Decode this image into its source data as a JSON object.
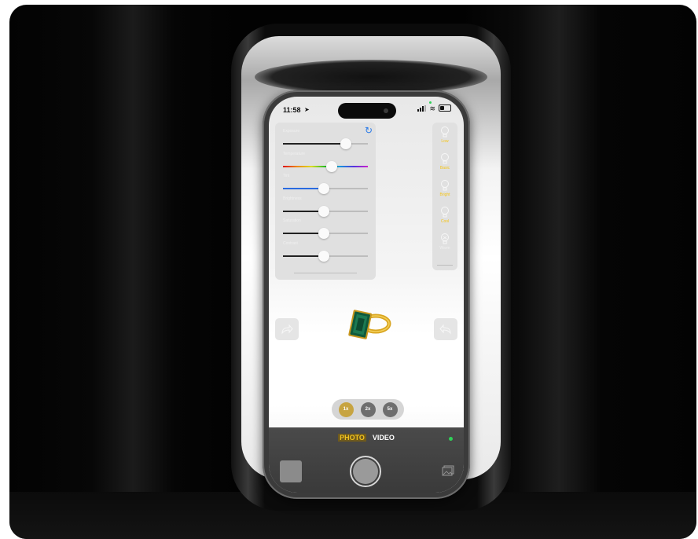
{
  "status_bar": {
    "time": "11:58",
    "location_arrow": "location-arrow-icon",
    "icons": [
      "signal-icon",
      "wifi-icon",
      "battery-icon"
    ]
  },
  "adjustments": {
    "reset_icon": "refresh-icon",
    "sliders": [
      {
        "label": "Exposure",
        "value": 0.74,
        "style": "dark"
      },
      {
        "label": "Temperature",
        "value": 0.57,
        "style": "rainbow"
      },
      {
        "label": "Tint",
        "value": 0.48,
        "style": "blue"
      },
      {
        "label": "Brightness",
        "value": 0.48,
        "style": "dark"
      },
      {
        "label": "Saturation",
        "value": 0.48,
        "style": "dark"
      },
      {
        "label": "Contrast",
        "value": 0.48,
        "style": "dark"
      }
    ]
  },
  "lighting": {
    "items": [
      {
        "label": "Low",
        "icon": "bulb-icon",
        "color": "#f5c518"
      },
      {
        "label": "Basic",
        "icon": "bulb-icon",
        "color": "#f5c518"
      },
      {
        "label": "Bright",
        "icon": "bulb-icon",
        "color": "#f5c518"
      },
      {
        "label": "Cool",
        "icon": "bulb-icon",
        "color": "#f5c518"
      },
      {
        "label": "Warm",
        "icon": "bulb-icon",
        "color": "#f0f0f0"
      }
    ]
  },
  "nav": {
    "left_icon": "redo-arrow-icon",
    "right_icon": "undo-arrow-icon"
  },
  "zoom": {
    "options": [
      "1x",
      "2x",
      "5x"
    ],
    "active": "1x"
  },
  "camera": {
    "modes": [
      "PHOTO",
      "VIDEO"
    ],
    "active_mode": "PHOTO",
    "accent_color": "#f0c21e"
  }
}
